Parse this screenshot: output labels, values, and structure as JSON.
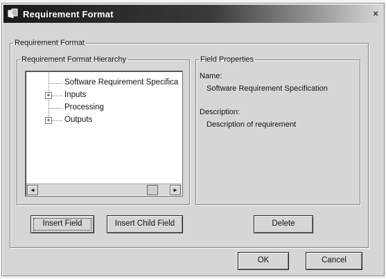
{
  "window": {
    "title": "Requirement Format",
    "close_glyph": "×"
  },
  "outer_group": {
    "legend": "Requirement Format"
  },
  "hierarchy": {
    "legend": "Requirement Format Hierarchy",
    "items": [
      {
        "label": "Software Requirement Specifica",
        "expandable": false,
        "expander_glyph": ""
      },
      {
        "label": "Inputs",
        "expandable": true,
        "expander_glyph": "+"
      },
      {
        "label": "Processing",
        "expandable": false,
        "expander_glyph": ""
      },
      {
        "label": "Outputs",
        "expandable": true,
        "expander_glyph": "+"
      }
    ],
    "scroll": {
      "left_glyph": "◄",
      "right_glyph": "►"
    }
  },
  "properties": {
    "legend": "Field Properties",
    "name_label": "Name:",
    "name_value": "Software Requirement Specification",
    "description_label": "Description:",
    "description_value": "Description of requirement"
  },
  "buttons": {
    "insert_field": "Insert Field",
    "insert_child_field": "Insert Child Field",
    "delete": "Delete",
    "ok": "OK",
    "cancel": "Cancel"
  }
}
